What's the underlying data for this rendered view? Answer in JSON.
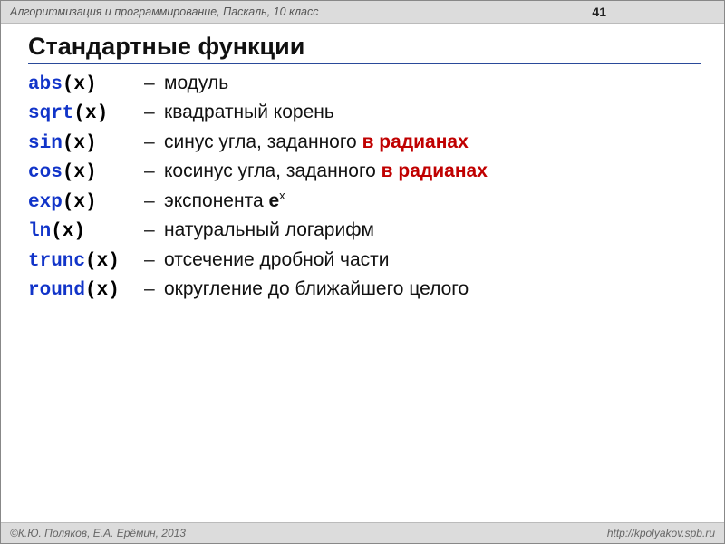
{
  "header": {
    "course": "Алгоритмизация и программирование, Паскаль, 10 класс",
    "page": "41"
  },
  "title": "Стандартные функции",
  "dash": "–",
  "functions": [
    {
      "name": "abs",
      "arg": "(x)",
      "desc_plain": "модуль",
      "desc_html": "модуль"
    },
    {
      "name": "sqrt",
      "arg": "(x)",
      "desc_plain": "квадратный корень",
      "desc_html": "квадратный корень"
    },
    {
      "name": "sin",
      "arg": "(x)",
      "desc_plain": "синус угла, заданного в радианах",
      "desc_html": "синус угла, заданного <span class=\"red\">в радианах</span>"
    },
    {
      "name": "cos",
      "arg": "(x)",
      "desc_plain": "косинус угла, заданного в радианах",
      "desc_html": "косинус угла, заданного <span class=\"red\">в радианах</span>"
    },
    {
      "name": "exp",
      "arg": "(x)",
      "desc_plain": "экспонента eˣ",
      "desc_html": "экспонента <span class=\"b\">e</span><sup>x</sup>"
    },
    {
      "name": "ln",
      "arg": "(x)",
      "desc_plain": "натуральный логарифм",
      "desc_html": "натуральный логарифм"
    },
    {
      "name": "trunc",
      "arg": "(x)",
      "desc_plain": "отсечение дробной части",
      "desc_html": "отсечение дробной части"
    },
    {
      "name": "round",
      "arg": "(x)",
      "desc_plain": "округление до ближайшего целого",
      "desc_html": "округление до ближайшего целого"
    }
  ],
  "footer": {
    "authors": "©К.Ю. Поляков, Е.А. Ерёмин, 2013",
    "url": "http://kpolyakov.spb.ru"
  }
}
